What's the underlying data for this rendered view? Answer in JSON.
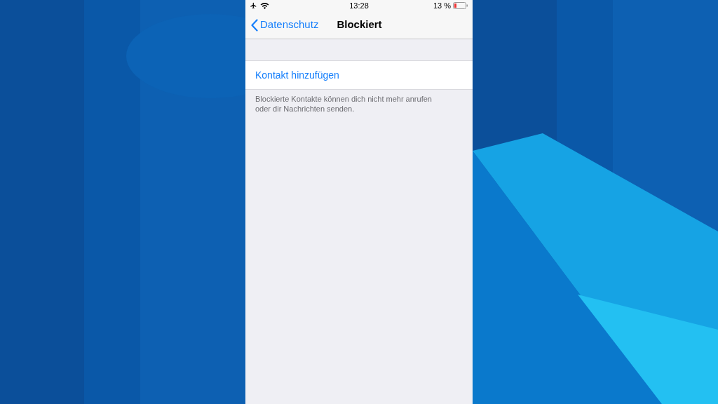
{
  "status_bar": {
    "time": "13:28",
    "battery": "13 %"
  },
  "nav_bar": {
    "back": "Datenschutz",
    "title": "Blockiert"
  },
  "list": {
    "items": [
      {
        "label": "Kontakt hinzufügen"
      }
    ],
    "footer": "Blockierte Kontakte können dich nicht mehr anrufen oder dir Nachrichten senden."
  }
}
